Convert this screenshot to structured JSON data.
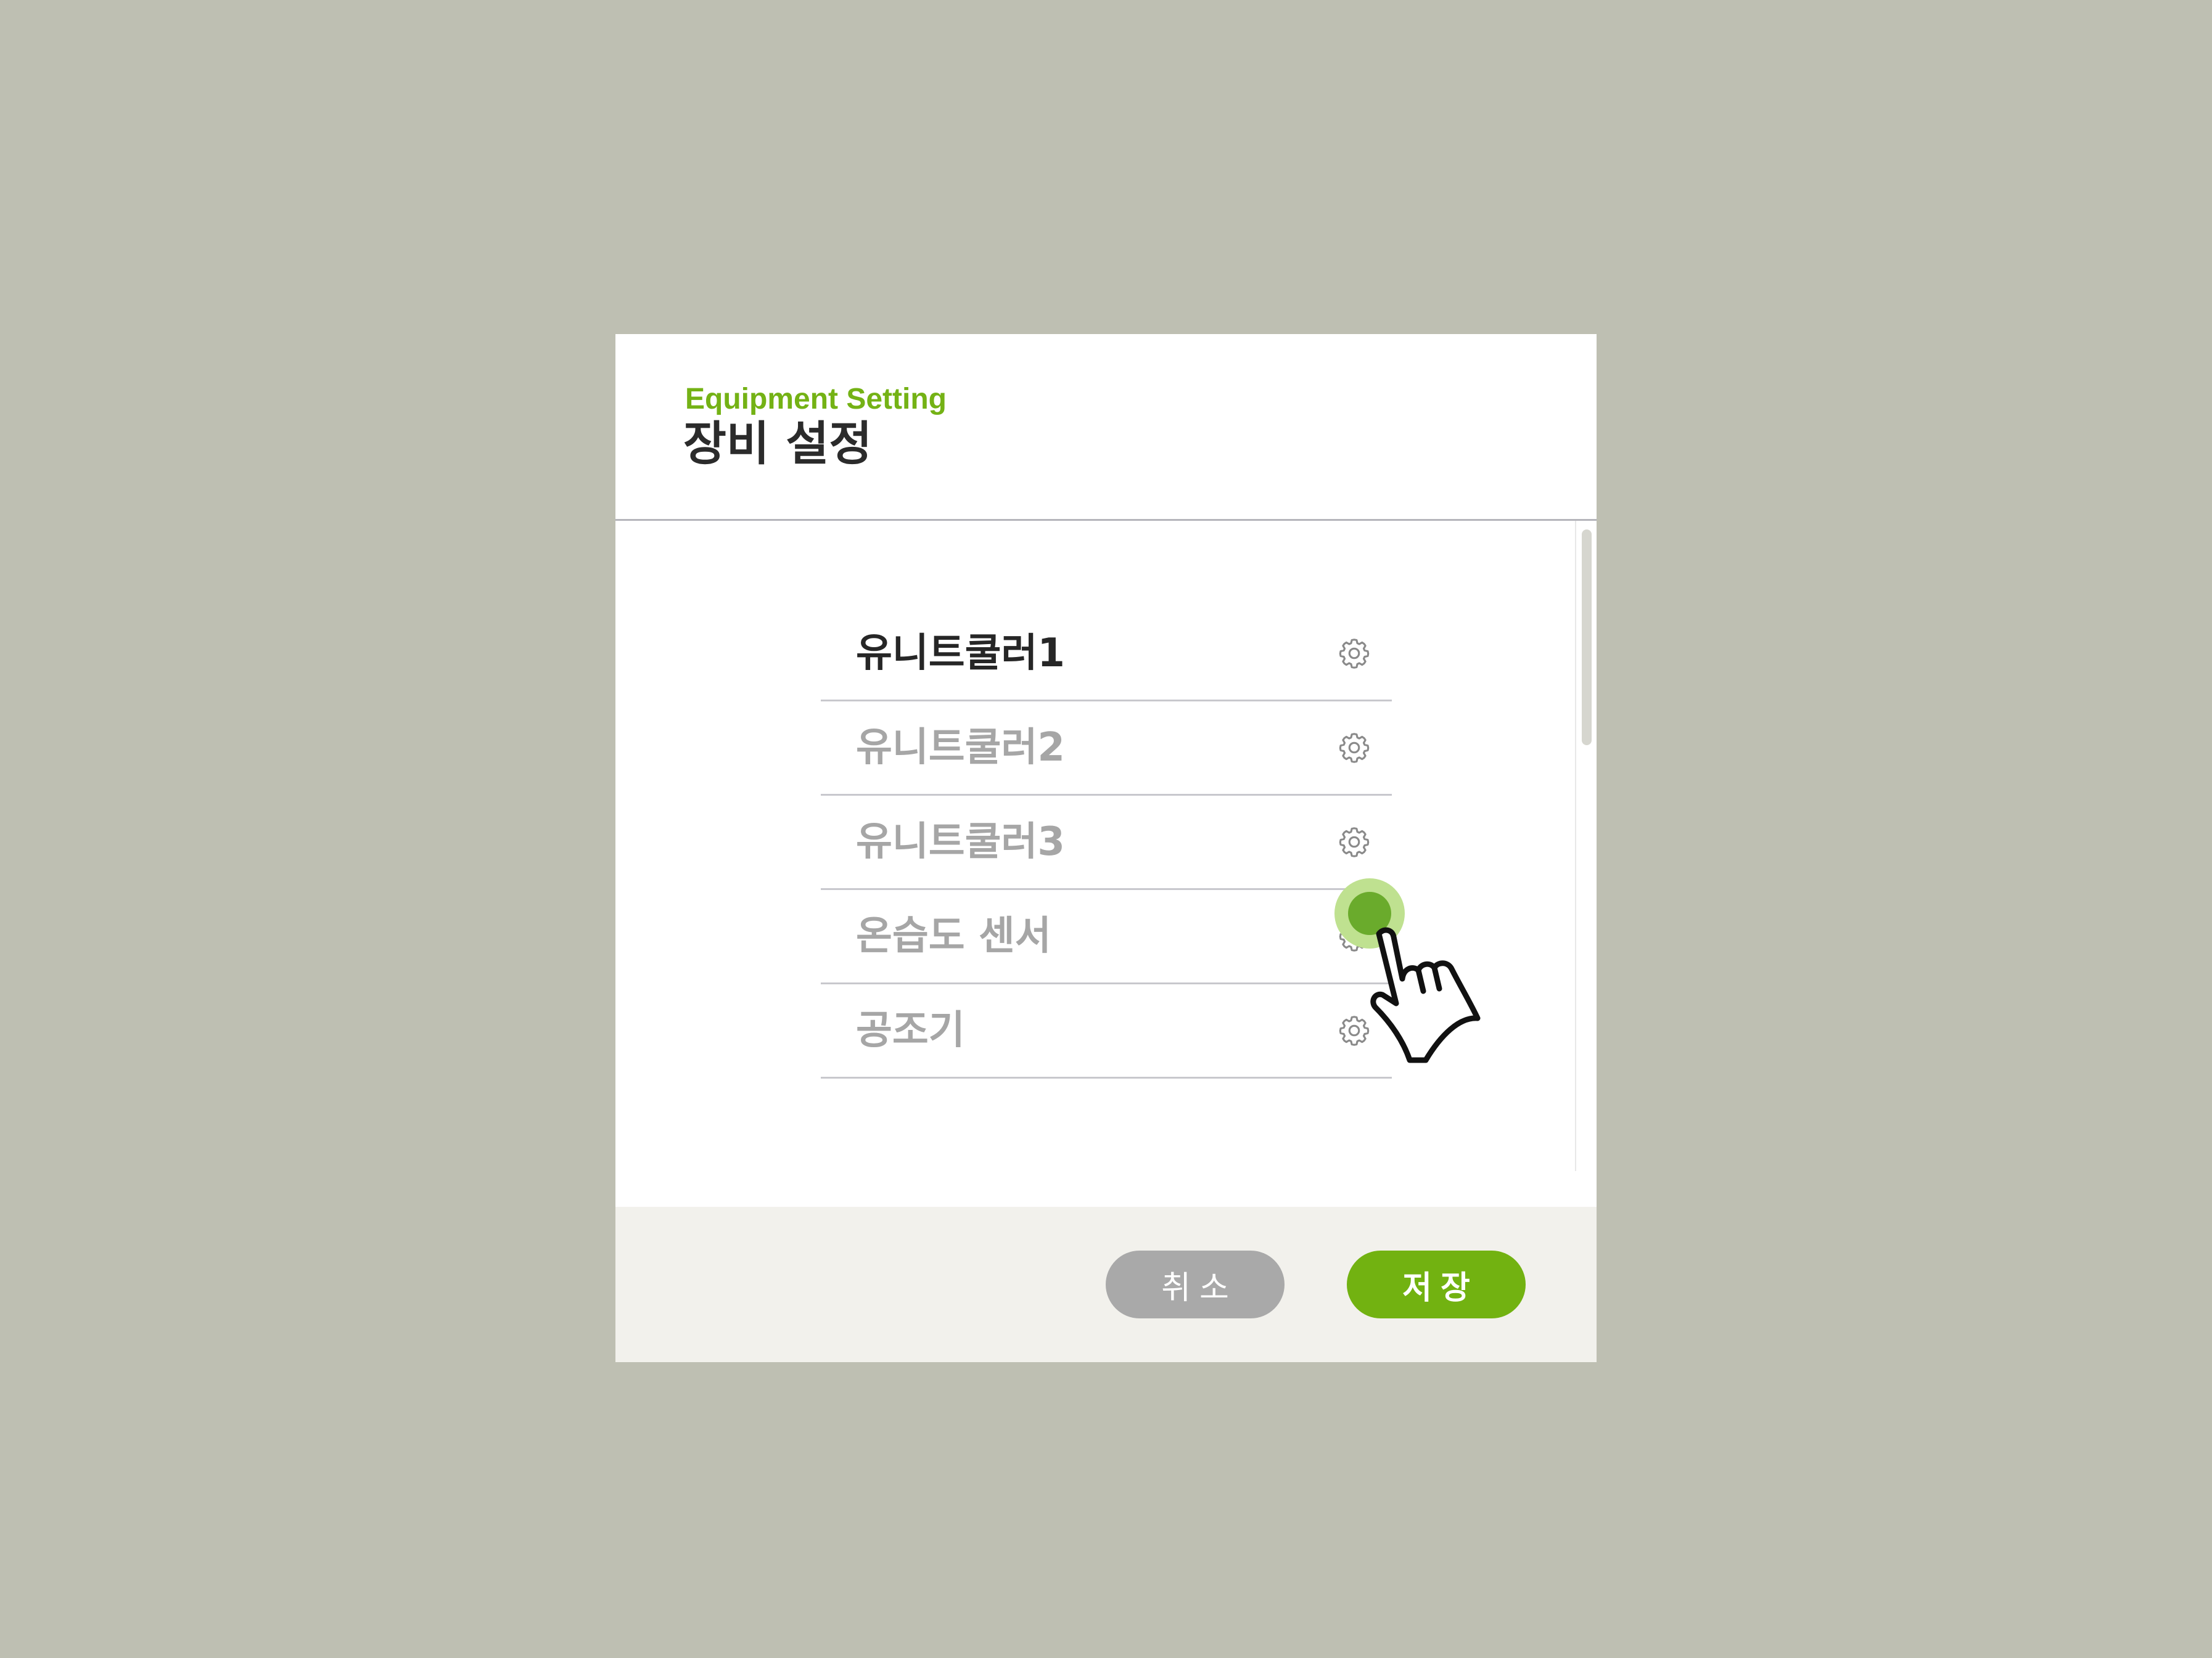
{
  "dialog": {
    "subtitle": "Equipment Setting",
    "title": "장비 설정"
  },
  "equipment_list": [
    {
      "label": "유니트쿨러1",
      "active": true,
      "icon": "gear-icon"
    },
    {
      "label": "유니트쿨러2",
      "active": false,
      "icon": "gear-icon"
    },
    {
      "label": "유니트쿨러3",
      "active": false,
      "icon": "gear-icon"
    },
    {
      "label": "온습도 센서",
      "active": false,
      "icon": "gear-icon"
    },
    {
      "label": "공조기",
      "active": false,
      "icon": "gear-icon"
    }
  ],
  "footer": {
    "cancel_label": "취소",
    "save_label": "저장"
  },
  "colors": {
    "accent": "#74b215",
    "background": "#bebfb2",
    "cancel": "#a9a9a9",
    "footer": "#f2f1ec"
  }
}
